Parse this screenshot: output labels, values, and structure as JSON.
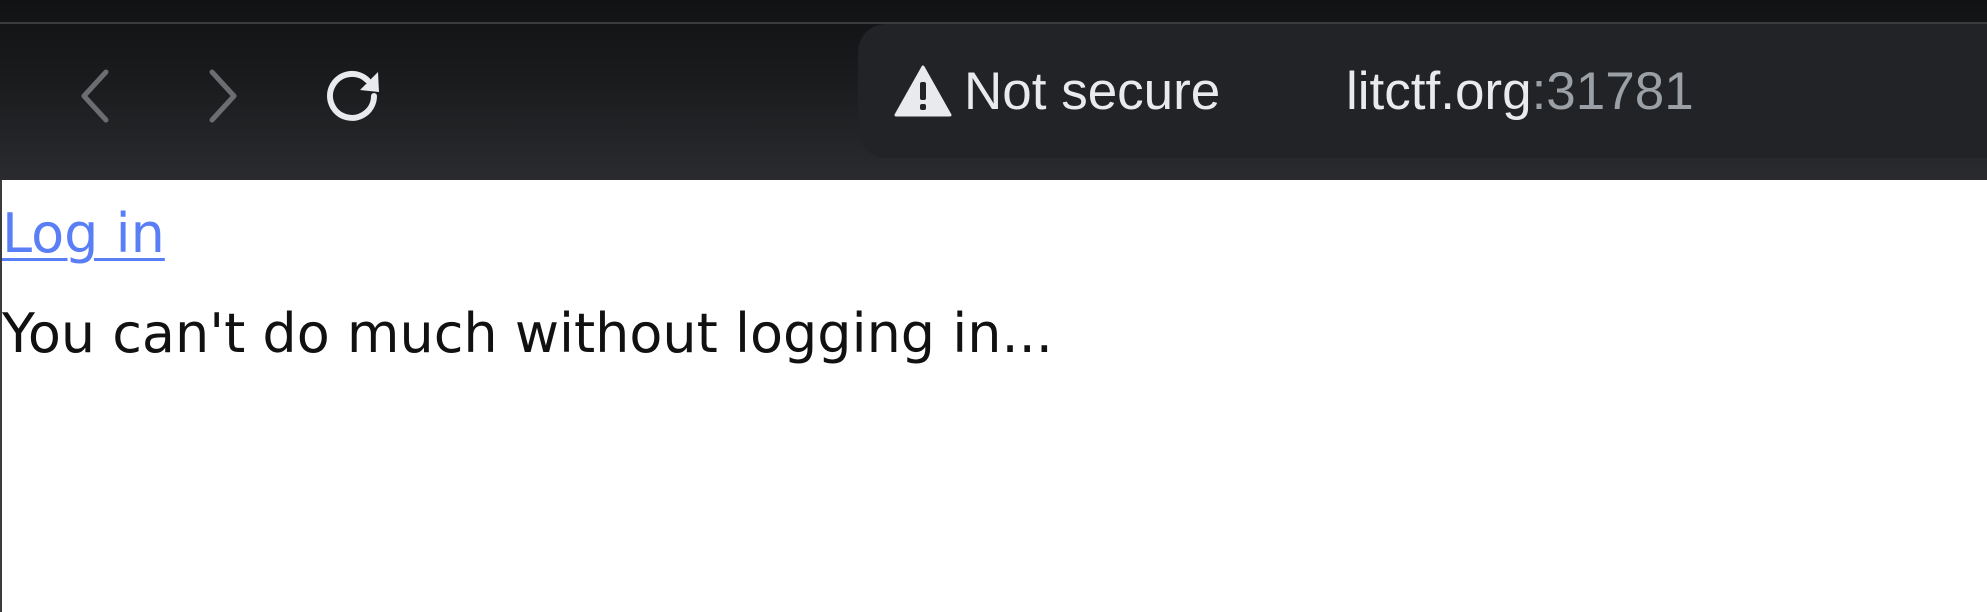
{
  "browser": {
    "nav": {
      "back_icon": "chevron-left-icon",
      "forward_icon": "chevron-right-icon",
      "reload_icon": "reload-icon"
    },
    "address_bar": {
      "security_icon": "warning-triangle-icon",
      "security_label": "Not secure",
      "url_host": "litctf.org",
      "url_port": ":31781"
    },
    "colors": {
      "toolbar_bg": "#1a1b1d",
      "omnibox_bg": "#222326",
      "text": "#e8eaed",
      "muted": "#9aa0a6"
    }
  },
  "page": {
    "login_link_label": "Log in",
    "message": "You can't do much without logging in...",
    "colors": {
      "link": "#5a7ef5",
      "text": "#111111",
      "background": "#ffffff"
    }
  }
}
